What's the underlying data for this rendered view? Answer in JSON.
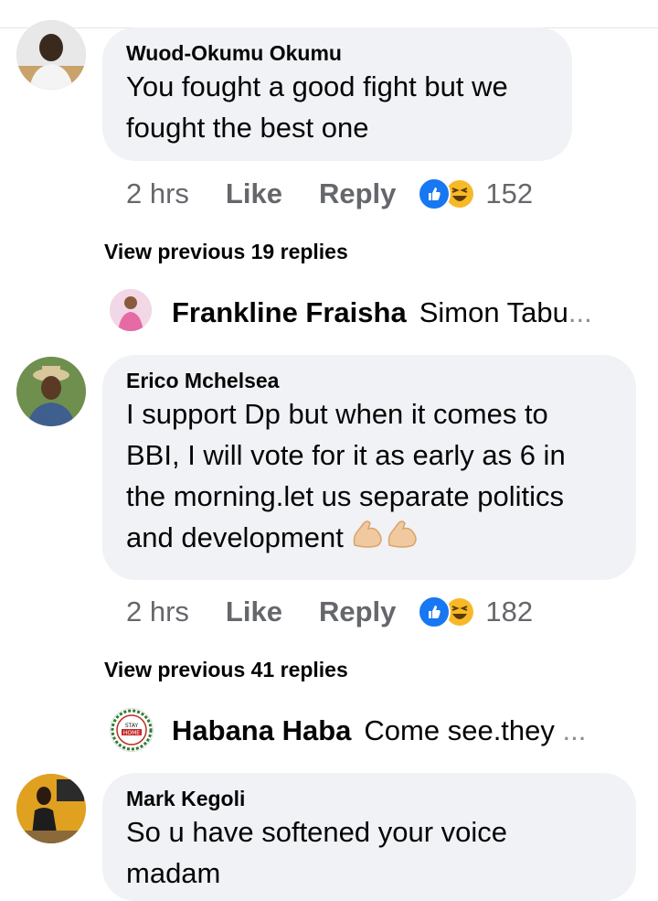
{
  "comments": [
    {
      "author": "Wuod-Okumu Okumu",
      "text_lines": [
        "You fought a good fight but we",
        "fought the best one"
      ],
      "time": "2 hrs",
      "like_label": "Like",
      "reply_label": "Reply",
      "reactions": [
        "like",
        "haha"
      ],
      "reaction_count": "152"
    },
    {
      "author": "Erico Mchelsea",
      "text_lines": [
        "I support Dp but when it comes to",
        "BBI, I will vote for it as early as 6 in",
        "the morning.let us separate politics",
        "and development"
      ],
      "emoji": [
        "flexed-biceps",
        "flexed-biceps"
      ],
      "time": "2 hrs",
      "like_label": "Like",
      "reply_label": "Reply",
      "reactions": [
        "like",
        "haha"
      ],
      "reaction_count": "182"
    },
    {
      "author": "Mark Kegoli",
      "text_lines": [
        "So u have softened your voice",
        "madam"
      ]
    }
  ],
  "view_previous": [
    "View previous 19 replies",
    "View previous 41 replies"
  ],
  "reply_previews": [
    {
      "author": "Frankline Fraisha",
      "text": "Simon Tabu",
      "ellipsis": "..."
    },
    {
      "author": "Habana Haba",
      "text": "Come see.they ",
      "ellipsis": "...",
      "avatar_badge": [
        "STAY",
        "HOME"
      ]
    }
  ],
  "colors": {
    "bubble": "#f0f2f5",
    "meta": "#65676b",
    "like_blue": "#1877f2",
    "haha_yellow": "#f7b928"
  }
}
